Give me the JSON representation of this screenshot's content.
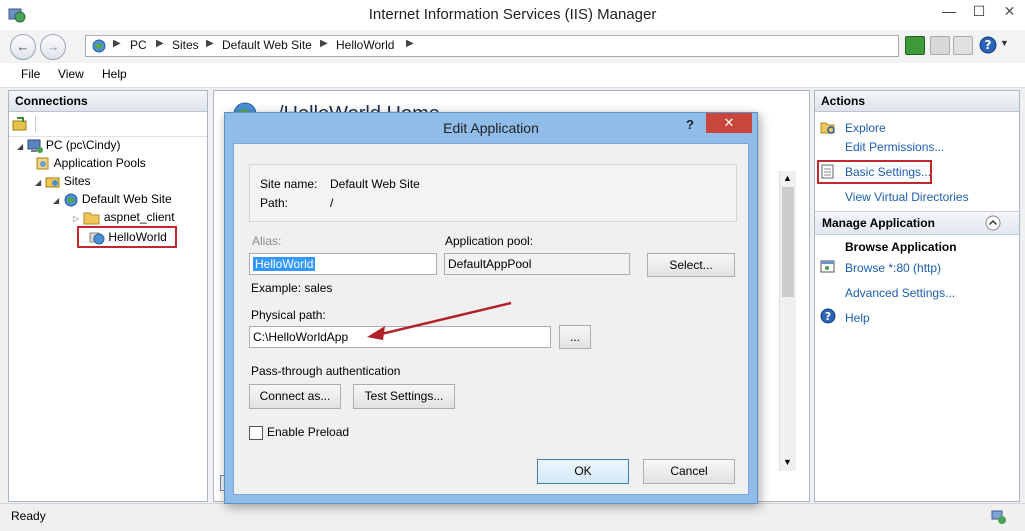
{
  "window": {
    "title": "Internet Information Services (IIS) Manager",
    "minimize": "—",
    "maximize": "☐",
    "close": "✕"
  },
  "address": {
    "crumbs": [
      "PC",
      "Sites",
      "Default Web Site",
      "HelloWorld"
    ]
  },
  "menu": {
    "file": "File",
    "view": "View",
    "help": "Help"
  },
  "connections": {
    "header": "Connections",
    "tree": {
      "pc": "PC (pc\\Cindy)",
      "app_pools": "Application Pools",
      "sites": "Sites",
      "default_site": "Default Web Site",
      "aspnet_client": "aspnet_client",
      "helloworld": "HelloWorld"
    }
  },
  "center": {
    "heading": "/HelloWorld Home"
  },
  "actions": {
    "header": "Actions",
    "explore": "Explore",
    "edit_permissions": "Edit Permissions...",
    "basic_settings": "Basic Settings...",
    "view_virtual_dirs": "View Virtual Directories",
    "manage_header": "Manage Application",
    "browse_header": "Browse Application",
    "browse_80": "Browse *:80 (http)",
    "advanced_settings": "Advanced Settings...",
    "help": "Help"
  },
  "status": {
    "text": "Ready"
  },
  "dialog": {
    "title": "Edit Application",
    "help_btn": "?",
    "close_btn": "✕",
    "site_name_label": "Site name:",
    "site_name_value": "Default Web Site",
    "path_label": "Path:",
    "path_value": "/",
    "alias_label": "Alias:",
    "alias_value": "HelloWorld",
    "alias_example": "Example: sales",
    "app_pool_label": "Application pool:",
    "app_pool_value": "DefaultAppPool",
    "select_btn": "Select...",
    "physical_path_label": "Physical path:",
    "physical_path_value": "C:\\HelloWorldApp",
    "browse_btn": "...",
    "pass_through_label": "Pass-through authentication",
    "connect_as_btn": "Connect as...",
    "test_settings_btn": "Test Settings...",
    "enable_preload_label": "Enable Preload",
    "enable_preload_checked": false,
    "ok_btn": "OK",
    "cancel_btn": "Cancel"
  },
  "colors": {
    "accent_link": "#1c5eb0",
    "highlight_red": "#c0282d",
    "dialog_frame": "#8fbce9",
    "close_red": "#c9463d"
  }
}
